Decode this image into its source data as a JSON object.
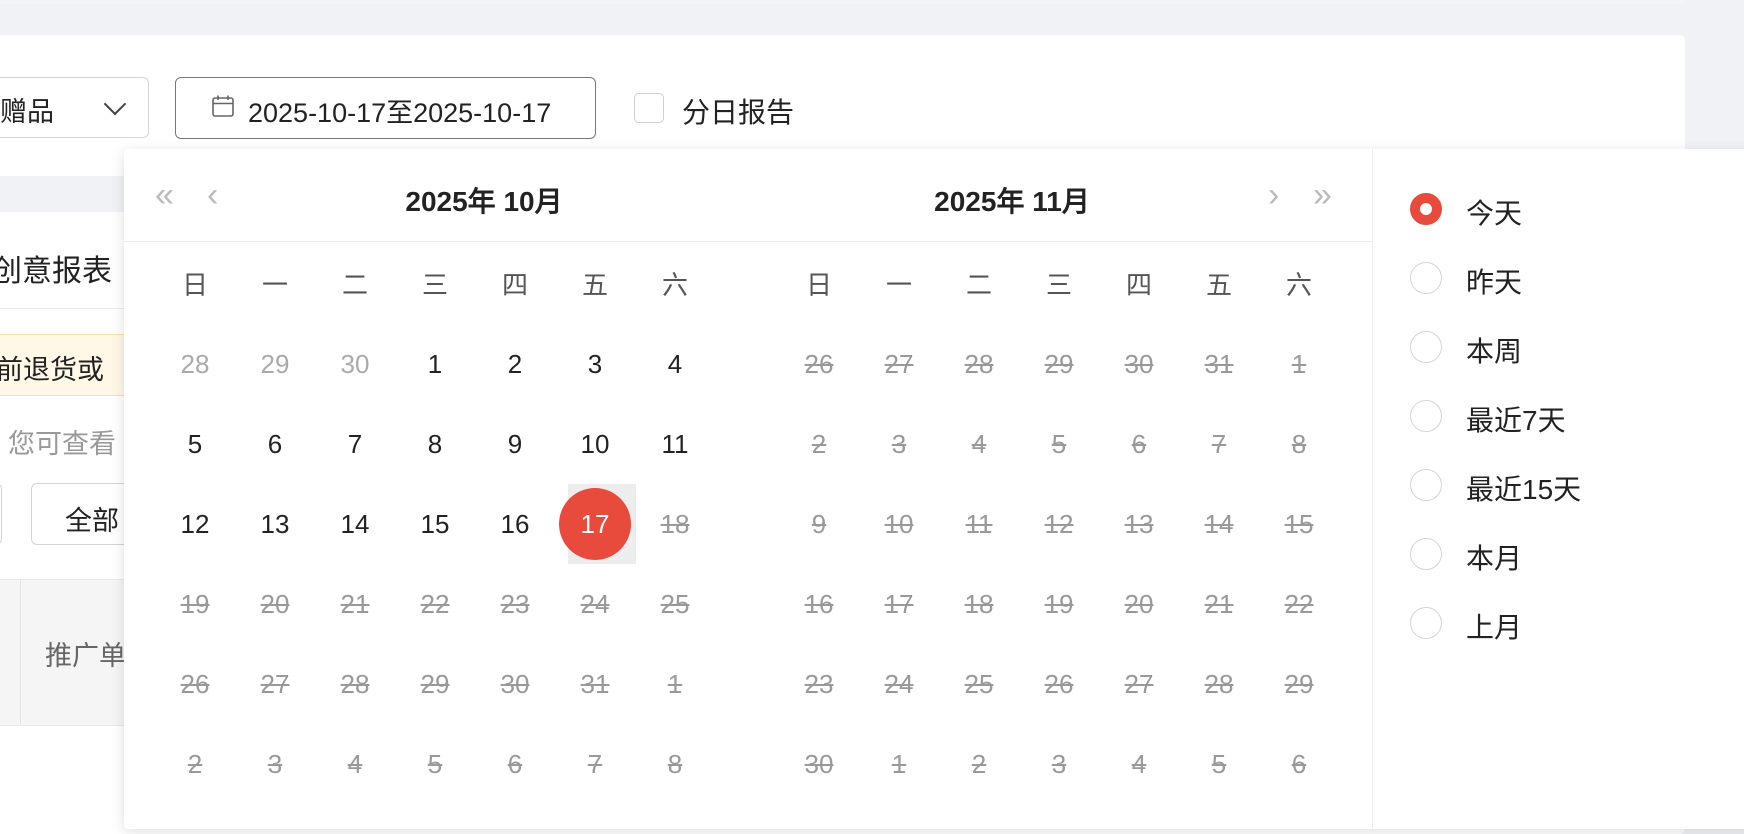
{
  "filter": {
    "select_value": "赠品",
    "date_range": "2025-10-17至2025-10-17",
    "daily_report_label": "分日报告"
  },
  "background": {
    "section_title": "创意报表",
    "warning_text": "前退货或",
    "hint_text": "您可查看",
    "all_button": "全部",
    "table_column": "推广单"
  },
  "picker": {
    "left_title": "2025年 10月",
    "right_title": "2025年 11月",
    "weekdays": [
      "日",
      "一",
      "二",
      "三",
      "四",
      "五",
      "六"
    ],
    "selected_date": "17",
    "left_days": [
      [
        "28",
        "29",
        "30",
        "1",
        "2",
        "3",
        "4"
      ],
      [
        "5",
        "6",
        "7",
        "8",
        "9",
        "10",
        "11"
      ],
      [
        "12",
        "13",
        "14",
        "15",
        "16",
        "17",
        "18"
      ],
      [
        "19",
        "20",
        "21",
        "22",
        "23",
        "24",
        "25"
      ],
      [
        "26",
        "27",
        "28",
        "29",
        "30",
        "31",
        "1"
      ],
      [
        "2",
        "3",
        "4",
        "5",
        "6",
        "7",
        "8"
      ]
    ],
    "right_days": [
      [
        "26",
        "27",
        "28",
        "29",
        "30",
        "31",
        "1"
      ],
      [
        "2",
        "3",
        "4",
        "5",
        "6",
        "7",
        "8"
      ],
      [
        "9",
        "10",
        "11",
        "12",
        "13",
        "14",
        "15"
      ],
      [
        "16",
        "17",
        "18",
        "19",
        "20",
        "21",
        "22"
      ],
      [
        "23",
        "24",
        "25",
        "26",
        "27",
        "28",
        "29"
      ],
      [
        "30",
        "1",
        "2",
        "3",
        "4",
        "5",
        "6"
      ]
    ],
    "presets": [
      "今天",
      "昨天",
      "本周",
      "最近7天",
      "最近15天",
      "本月",
      "上月"
    ],
    "selected_preset": "今天"
  },
  "colors": {
    "accent": "#e84a3c"
  }
}
